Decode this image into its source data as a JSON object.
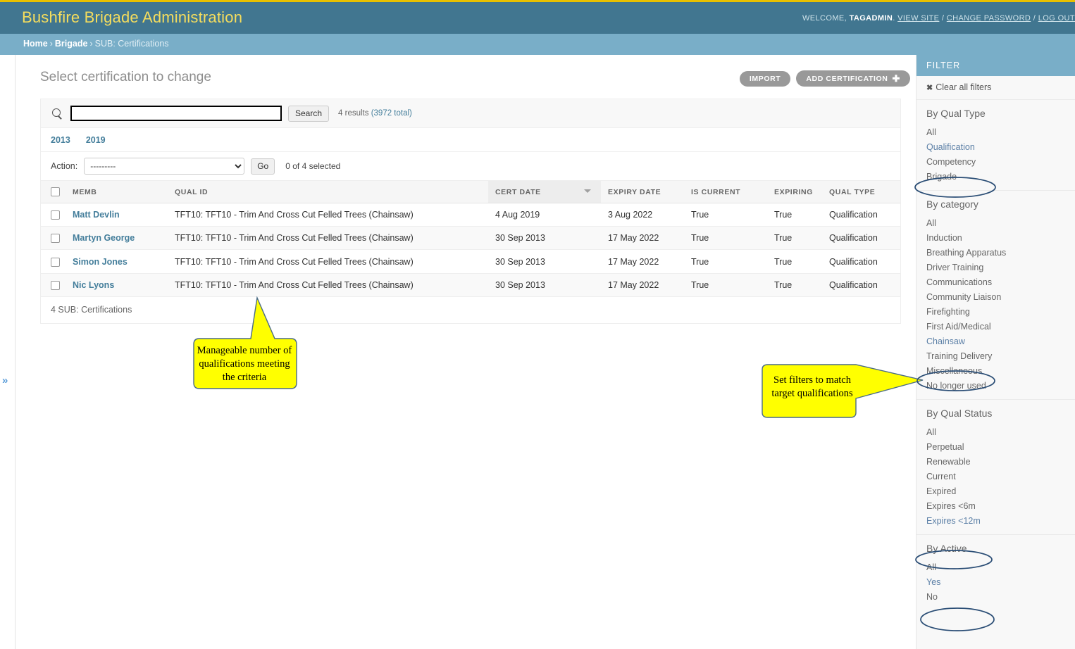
{
  "header": {
    "brand": "Bushfire Brigade Administration",
    "welcome_prefix": "WELCOME,",
    "username": "TAGADMIN",
    "dot": ".",
    "view_site": "VIEW SITE",
    "change_password": "CHANGE PASSWORD",
    "log_out": "LOG OUT",
    "sep": "/"
  },
  "breadcrumbs": {
    "home": "Home",
    "brigade": "Brigade",
    "current": "SUB: Certifications",
    "separator": "›"
  },
  "rail": {
    "toggle_icon": "»"
  },
  "page": {
    "title": "Select certification to change"
  },
  "object_tools": {
    "import_label": "IMPORT",
    "add_label": "ADD CERTIFICATION",
    "add_plus": "✚"
  },
  "search": {
    "value": "",
    "placeholder": "",
    "button_label": "Search",
    "results_text": "4 results",
    "total_text": "(3972 total)"
  },
  "date_hierarchy": {
    "years": [
      "2013",
      "2019"
    ]
  },
  "actions": {
    "label": "Action:",
    "selected": "---------",
    "options": [
      "---------"
    ],
    "go_label": "Go",
    "selected_count": "0 of 4 selected"
  },
  "table": {
    "columns": [
      {
        "key": "memb",
        "label": "MEMB",
        "sorted": false
      },
      {
        "key": "qual_id",
        "label": "QUAL ID",
        "sorted": false
      },
      {
        "key": "cert_date",
        "label": "CERT DATE",
        "sorted": true
      },
      {
        "key": "expiry_date",
        "label": "EXPIRY DATE",
        "sorted": false
      },
      {
        "key": "is_current",
        "label": "IS CURRENT",
        "sorted": false
      },
      {
        "key": "expiring",
        "label": "EXPIRING",
        "sorted": false
      },
      {
        "key": "qual_type",
        "label": "QUAL TYPE",
        "sorted": false
      }
    ],
    "rows": [
      {
        "memb": "Matt Devlin",
        "qual_id": "TFT10: TFT10 - Trim And Cross Cut Felled Trees (Chainsaw)",
        "cert_date": "4 Aug 2019",
        "expiry_date": "3 Aug 2022",
        "is_current": "True",
        "expiring": "True",
        "qual_type": "Qualification"
      },
      {
        "memb": "Martyn George",
        "qual_id": "TFT10: TFT10 - Trim And Cross Cut Felled Trees (Chainsaw)",
        "cert_date": "30 Sep 2013",
        "expiry_date": "17 May 2022",
        "is_current": "True",
        "expiring": "True",
        "qual_type": "Qualification"
      },
      {
        "memb": "Simon Jones",
        "qual_id": "TFT10: TFT10 - Trim And Cross Cut Felled Trees (Chainsaw)",
        "cert_date": "30 Sep 2013",
        "expiry_date": "17 May 2022",
        "is_current": "True",
        "expiring": "True",
        "qual_type": "Qualification"
      },
      {
        "memb": "Nic Lyons",
        "qual_id": "TFT10: TFT10 - Trim And Cross Cut Felled Trees (Chainsaw)",
        "cert_date": "30 Sep 2013",
        "expiry_date": "17 May 2022",
        "is_current": "True",
        "expiring": "True",
        "qual_type": "Qualification"
      }
    ],
    "footer": "4 SUB: Certifications"
  },
  "filter": {
    "header": "FILTER",
    "clear_all": "Clear all filters",
    "clear_icon": "✖",
    "groups": [
      {
        "title": "By Qual Type",
        "items": [
          {
            "label": "All",
            "selected": false
          },
          {
            "label": "Qualification",
            "selected": true
          },
          {
            "label": "Competency",
            "selected": false
          },
          {
            "label": "Brigade",
            "selected": false
          }
        ]
      },
      {
        "title": "By category",
        "items": [
          {
            "label": "All",
            "selected": false
          },
          {
            "label": "Induction",
            "selected": false
          },
          {
            "label": "Breathing Apparatus",
            "selected": false
          },
          {
            "label": "Driver Training",
            "selected": false
          },
          {
            "label": "Communications",
            "selected": false
          },
          {
            "label": "Community Liaison",
            "selected": false
          },
          {
            "label": "Firefighting",
            "selected": false
          },
          {
            "label": "First Aid/Medical",
            "selected": false
          },
          {
            "label": "Chainsaw",
            "selected": true
          },
          {
            "label": "Training Delivery",
            "selected": false
          },
          {
            "label": "Miscellaneous",
            "selected": false
          },
          {
            "label": "No longer used",
            "selected": false
          }
        ]
      },
      {
        "title": "By Qual Status",
        "items": [
          {
            "label": "All",
            "selected": false
          },
          {
            "label": "Perpetual",
            "selected": false
          },
          {
            "label": "Renewable",
            "selected": false
          },
          {
            "label": "Current",
            "selected": false
          },
          {
            "label": "Expired",
            "selected": false
          },
          {
            "label": "Expires <6m",
            "selected": false
          },
          {
            "label": "Expires <12m",
            "selected": true
          }
        ]
      },
      {
        "title": "By Active",
        "items": [
          {
            "label": "All",
            "selected": false
          },
          {
            "label": "Yes",
            "selected": true
          },
          {
            "label": "No",
            "selected": false
          }
        ]
      }
    ]
  },
  "annotations": {
    "callout1": "Manageable number of qualifications meeting the criteria",
    "callout2": "Set filters to match target qualifications",
    "fill_color": "#ffff00",
    "stroke_color": "#2f4f6f",
    "ellipse_color": "#2a4d75"
  }
}
